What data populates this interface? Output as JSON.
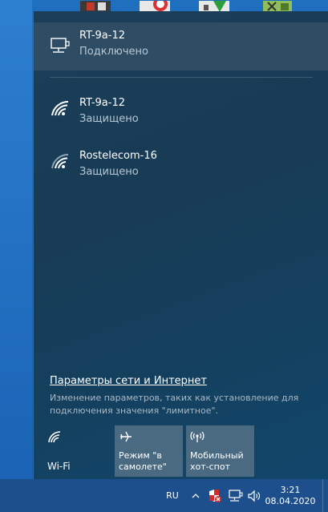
{
  "flyout": {
    "networks": [
      {
        "name": "RT-9a-12",
        "status": "Подключено",
        "icon": "ethernet-icon",
        "connected": true
      },
      {
        "name": "RT-9a-12",
        "status": "Защищено",
        "icon": "wifi-icon"
      },
      {
        "name": "Rostelecom-16",
        "status": "Защищено",
        "icon": "wifi-icon"
      }
    ],
    "settings_link": "Параметры сети и Интернет",
    "settings_desc": "Изменение параметров, таких как установление для подключения значения \"лимитное\".",
    "tiles": [
      {
        "label": "Wi-Fi",
        "icon": "wifi-icon"
      },
      {
        "label_line1": "Режим \"в",
        "label_line2": "самолете\"",
        "icon": "airplane-icon"
      },
      {
        "label_line1": "Мобильный",
        "label_line2": "хот-спот",
        "icon": "hotspot-icon"
      }
    ]
  },
  "taskbar": {
    "language": "RU",
    "time": "3:21",
    "date": "08.04.2020"
  },
  "colors": {
    "flyout_bg": "#1b3a52",
    "connected_highlight": "#2e4c63",
    "tile_active": "#4a6a82",
    "taskbar": "#1c4f8c",
    "desktop": "#1f6fbf"
  }
}
